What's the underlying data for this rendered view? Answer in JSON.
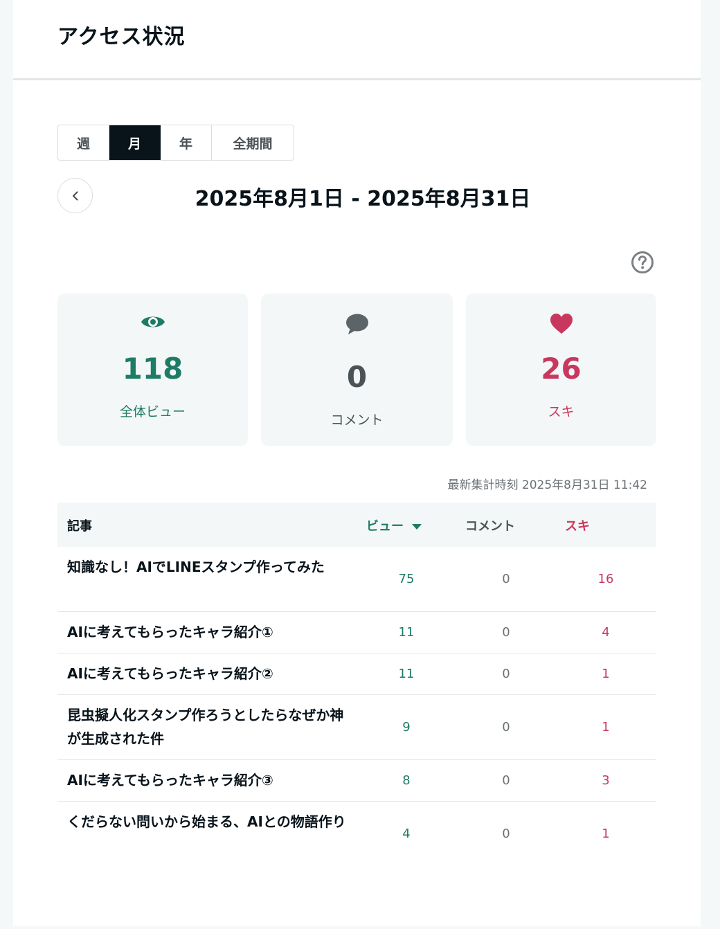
{
  "header": {
    "title": "アクセス状況"
  },
  "tabs": [
    {
      "label": "週",
      "active": false
    },
    {
      "label": "月",
      "active": true
    },
    {
      "label": "年",
      "active": false
    },
    {
      "label": "全期間",
      "active": false
    }
  ],
  "date_range": "2025年8月1日 - 2025年8月31日",
  "icons": {
    "prev": "chevron-left-icon",
    "help": "question-circle-icon",
    "views": "eye-icon",
    "comments": "speech-bubble-icon",
    "likes": "heart-icon"
  },
  "summary": {
    "views": {
      "value": "118",
      "label": "全体ビュー"
    },
    "comments": {
      "value": "0",
      "label": "コメント"
    },
    "likes": {
      "value": "26",
      "label": "スキ"
    }
  },
  "updated_at": "最新集計時刻 2025年8月31日 11:42",
  "table": {
    "headers": {
      "article": "記事",
      "views": "ビュー",
      "comments": "コメント",
      "likes": "スキ"
    },
    "rows": [
      {
        "title": "知識なし！AIでLINEスタンプ作ってみた",
        "views": "75",
        "comments": "0",
        "likes": "16"
      },
      {
        "title": "AIに考えてもらったキャラ紹介①",
        "views": "11",
        "comments": "0",
        "likes": "4"
      },
      {
        "title": "AIに考えてもらったキャラ紹介②",
        "views": "11",
        "comments": "0",
        "likes": "1"
      },
      {
        "title": "昆虫擬人化スタンプ作ろうとしたらなぜか神が生成された件",
        "views": "9",
        "comments": "0",
        "likes": "1"
      },
      {
        "title": "AIに考えてもらったキャラ紹介③",
        "views": "8",
        "comments": "0",
        "likes": "3"
      },
      {
        "title": "くだらない問いから始まる、AIとの物語作り",
        "views": "4",
        "comments": "0",
        "likes": "1"
      }
    ]
  },
  "colors": {
    "views": "#1e7b65",
    "comments": "#4b5357",
    "likes": "#c8385e",
    "active_tab": "#08131a"
  }
}
